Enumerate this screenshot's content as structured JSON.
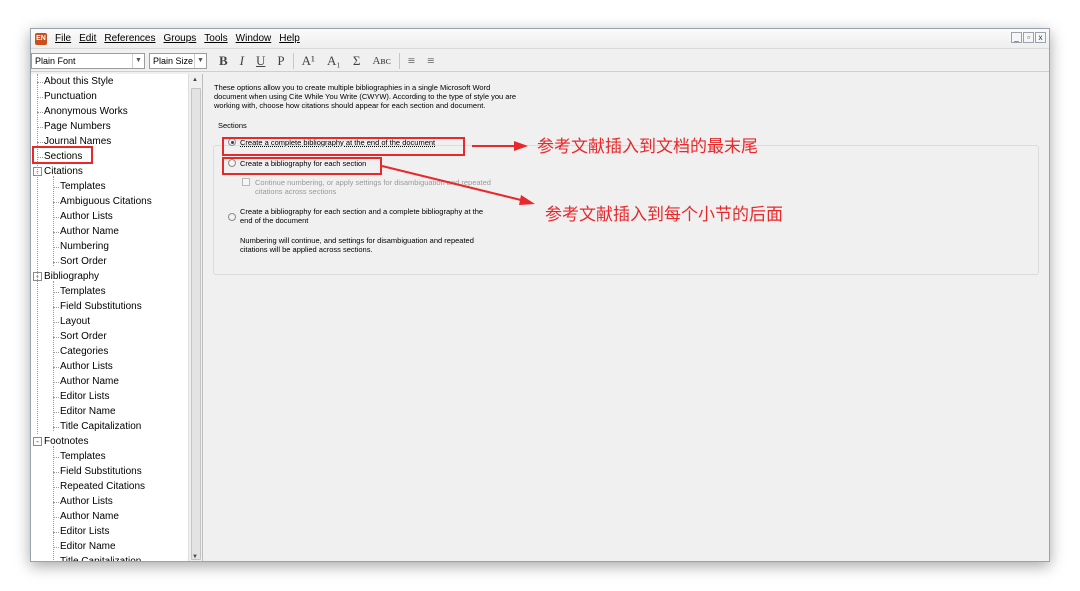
{
  "app": {
    "icon": "endnote-app-icon",
    "menu": [
      "File",
      "Edit",
      "References",
      "Groups",
      "Tools",
      "Window",
      "Help"
    ],
    "window_controls": [
      "_",
      "ₔ",
      "x"
    ]
  },
  "toolbar": {
    "font": "Plain Font",
    "size": "Plain Size",
    "buttons": [
      "B",
      "I",
      "U",
      "P",
      "A¹",
      "A₁",
      "Σ",
      "Aʙᴄ",
      "≡",
      "≡"
    ]
  },
  "tree": [
    {
      "label": "About this Style",
      "level": 0,
      "selected": false
    },
    {
      "label": "Punctuation",
      "level": 0
    },
    {
      "label": "Anonymous Works",
      "level": 0
    },
    {
      "label": "Page Numbers",
      "level": 0
    },
    {
      "label": "Journal Names",
      "level": 0
    },
    {
      "label": "Sections",
      "level": 0,
      "highlighted": true
    },
    {
      "label": "Citations",
      "level": 0,
      "expander": "-"
    },
    {
      "label": "Templates",
      "level": 1
    },
    {
      "label": "Ambiguous Citations",
      "level": 1
    },
    {
      "label": "Author Lists",
      "level": 1
    },
    {
      "label": "Author Name",
      "level": 1
    },
    {
      "label": "Numbering",
      "level": 1
    },
    {
      "label": "Sort Order",
      "level": 1
    },
    {
      "label": "Bibliography",
      "level": 0,
      "expander": "-"
    },
    {
      "label": "Templates",
      "level": 1
    },
    {
      "label": "Field Substitutions",
      "level": 1
    },
    {
      "label": "Layout",
      "level": 1
    },
    {
      "label": "Sort Order",
      "level": 1
    },
    {
      "label": "Categories",
      "level": 1
    },
    {
      "label": "Author Lists",
      "level": 1
    },
    {
      "label": "Author Name",
      "level": 1
    },
    {
      "label": "Editor Lists",
      "level": 1
    },
    {
      "label": "Editor Name",
      "level": 1
    },
    {
      "label": "Title Capitalization",
      "level": 1
    },
    {
      "label": "Footnotes",
      "level": 0,
      "expander": "-"
    },
    {
      "label": "Templates",
      "level": 1
    },
    {
      "label": "Field Substitutions",
      "level": 1
    },
    {
      "label": "Repeated Citations",
      "level": 1
    },
    {
      "label": "Author Lists",
      "level": 1
    },
    {
      "label": "Author Name",
      "level": 1
    },
    {
      "label": "Editor Lists",
      "level": 1
    },
    {
      "label": "Editor Name",
      "level": 1
    },
    {
      "label": "Title Capitalization",
      "level": 1
    }
  ],
  "content": {
    "description_lines": [
      "These options allow you to create multiple bibliographies in a single Microsoft Word",
      "document when using Cite While You Write (CWYW). According to the type of style you are",
      "working with, choose how citations should appear for each section and document."
    ],
    "group_title": "Sections",
    "option1": "Create a complete bibliography at the end of the document",
    "option2": "Create a bibliography for each section",
    "option2_sub": [
      "Continue numbering, or apply settings for disambiguation and repeated",
      "citations across sections"
    ],
    "option3": [
      "Create a bibliography for each section and a complete bibliography at the",
      "end of the document"
    ],
    "option3_note": [
      "Numbering will continue, and settings for disambiguation and repeated",
      "citations will be applied across sections."
    ]
  },
  "annotations": {
    "a1": "参考文献插入到文档的最末尾",
    "a2": "参考文献插入到每个小节的后面",
    "color": "#e8282b"
  }
}
